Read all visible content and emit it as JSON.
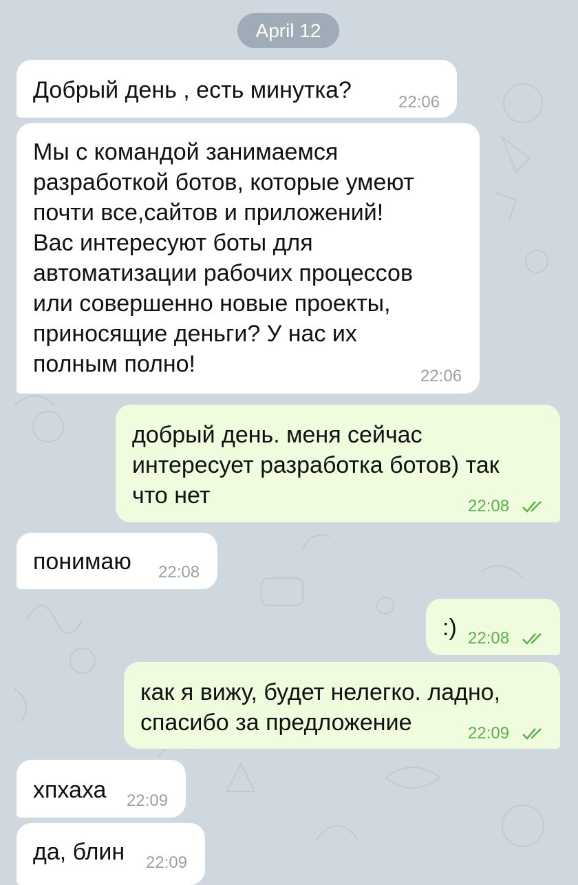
{
  "date_chip": "April 12",
  "messages": [
    {
      "text": "Добрый день , есть минутка?",
      "time": "22:06"
    },
    {
      "text": "Мы с командой занимаемся\nразработкой ботов, которые умеют\nпочти все,сайтов и приложений!\nВас интересуют боты для\nавтоматизации рабочих процессов\nили совершенно новые проекты,\nприносящие деньги? У нас их\nполным полно!",
      "time": "22:06"
    },
    {
      "text": "добрый день. меня сейчас\nинтересует разработка ботов) так\nчто нет",
      "time": "22:08"
    },
    {
      "text": "понимаю",
      "time": "22:08"
    },
    {
      "text": ":)",
      "time": "22:08"
    },
    {
      "text": "как я вижу, будет нелегко. ладно,\nспасибо за предложение",
      "time": "22:09"
    },
    {
      "text": "хпхаха",
      "time": "22:09"
    },
    {
      "text": "да, блин",
      "time": "22:09"
    }
  ],
  "colors": {
    "background": "#cfd8df",
    "incoming_bubble": "#ffffff",
    "outgoing_bubble": "#effdde",
    "read_check": "#5eaf4b"
  },
  "icons": [
    "double-check-icon"
  ]
}
